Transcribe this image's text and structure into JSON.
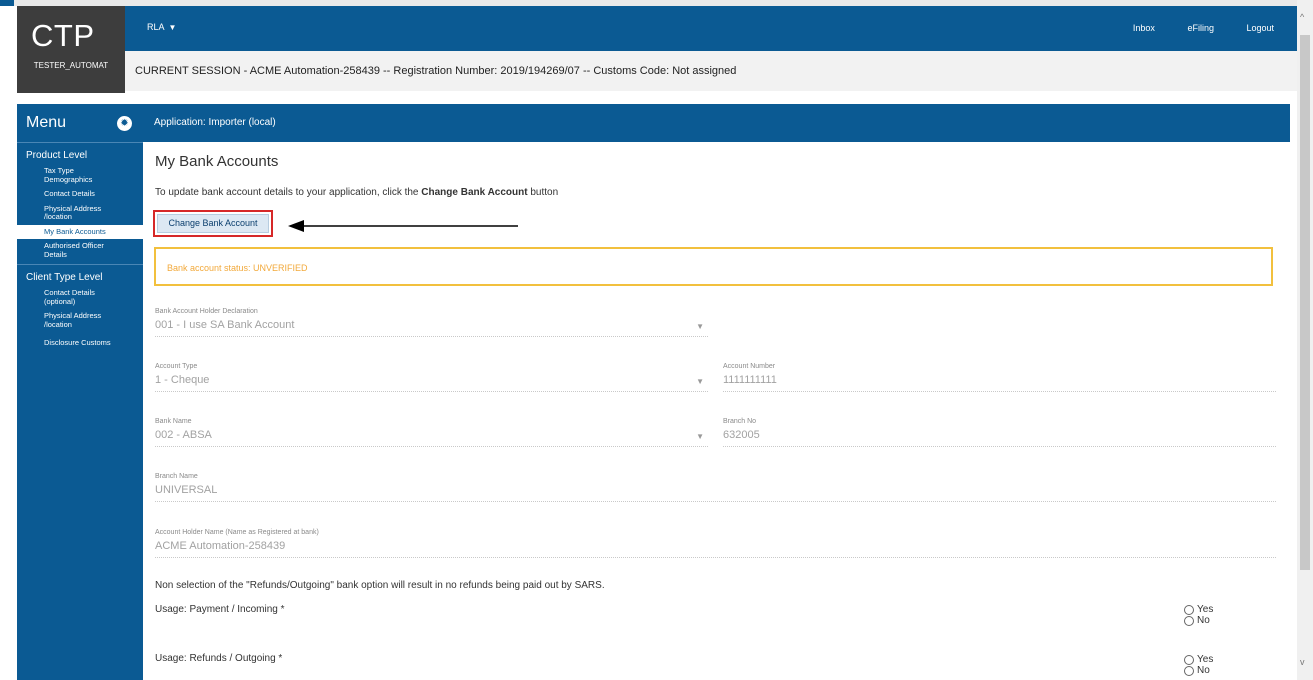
{
  "header": {
    "logo_text": "CTP",
    "username": "TESTER_AUTOMAT",
    "menu_dropdown": "RLA",
    "nav": [
      "Inbox",
      "eFiling",
      "Logout"
    ],
    "session_text": "CURRENT SESSION - ACME Automation-258439 -- Registration Number: 2019/194269/07 -- Customs Code: Not assigned"
  },
  "sidebar": {
    "title": "Menu",
    "sections": [
      {
        "title": "Product Level",
        "items": [
          {
            "label": "Tax Type Demographics"
          },
          {
            "label": "Contact Details"
          },
          {
            "label": "Physical Address /location"
          },
          {
            "label": "My Bank Accounts",
            "active": true
          },
          {
            "label": "Authorised Officer Details"
          }
        ]
      },
      {
        "title": "Client Type Level",
        "items": [
          {
            "label": "Contact Details (optional)"
          },
          {
            "label": "Physical Address /location"
          },
          {
            "label": "Disclosure Customs"
          }
        ]
      }
    ]
  },
  "app_header": "Application: Importer (local)",
  "page": {
    "title": "My Bank Accounts",
    "instruction_pre": "To update bank account details to your application, click the ",
    "instruction_bold": "Change Bank Account",
    "instruction_post": " button",
    "change_button": "Change Bank Account",
    "status": "Bank account status: UNVERIFIED",
    "fields": {
      "declaration": {
        "label": "Bank Account Holder Declaration",
        "value": "001 - I use SA Bank Account"
      },
      "account_type": {
        "label": "Account Type",
        "value": "1 - Cheque"
      },
      "account_number": {
        "label": "Account Number",
        "value": "1111111111"
      },
      "bank_name": {
        "label": "Bank Name",
        "value": "002 - ABSA"
      },
      "branch_no": {
        "label": "Branch No",
        "value": "632005"
      },
      "branch_name": {
        "label": "Branch Name",
        "value": "UNIVERSAL"
      },
      "holder_name": {
        "label": "Account Holder Name (Name as Registered at bank)",
        "value": "ACME Automation-258439"
      }
    },
    "note": "Non selection of the \"Refunds/Outgoing\" bank option will result in no refunds being paid out by SARS.",
    "usage_payment": "Usage: Payment / Incoming *",
    "usage_refunds": "Usage: Refunds / Outgoing *",
    "yes": "Yes",
    "no": "No"
  },
  "colors": {
    "brand": "#0b5a93",
    "highlight": "#d62828",
    "warning": "#f2c03d"
  }
}
